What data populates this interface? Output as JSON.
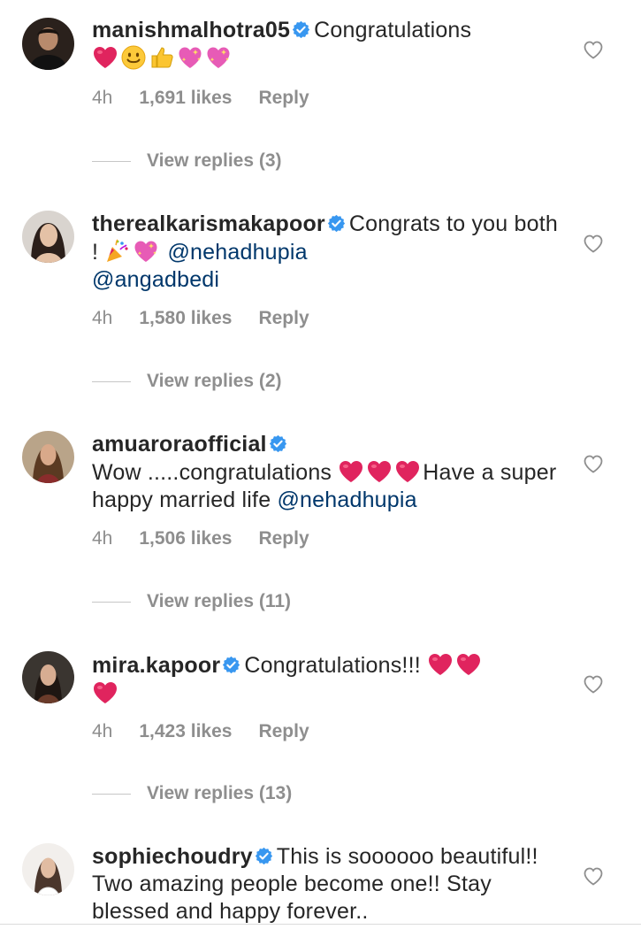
{
  "comments": [
    {
      "username": "manishmalhotra05",
      "text": "Congratulations",
      "time": "4h",
      "likes": "1,691 likes",
      "reply": "Reply",
      "view_replies": "View replies (3)"
    },
    {
      "username": "therealkarismakapoor",
      "text_1": "Congrats to you both !",
      "mention_1": "@nehadhupia",
      "mention_2": "@angadbedi",
      "time": "4h",
      "likes": "1,580 likes",
      "reply": "Reply",
      "view_replies": "View replies (2)"
    },
    {
      "username": "amuaroraofficial",
      "text_1": "Wow .....congratulations",
      "text_2": "Have a super happy married life",
      "mention_1": "@nehadhupia",
      "time": "4h",
      "likes": "1,506 likes",
      "reply": "Reply",
      "view_replies": "View replies (11)"
    },
    {
      "username": "mira.kapoor",
      "text": "Congratulations!!!",
      "time": "4h",
      "likes": "1,423 likes",
      "reply": "Reply",
      "view_replies": "View replies (13)"
    },
    {
      "username": "sophiechoudry",
      "text": "This is soooooo beautiful!! Two amazing people become one!! Stay blessed and happy forever.."
    }
  ],
  "colors": {
    "verified": "#3897f0",
    "mention": "#00376b",
    "secondary_text": "#8e8e8e",
    "heart_emoji": "#e0245e"
  },
  "icons": {
    "verified": "verified-badge-icon",
    "like": "heart-outline-icon"
  }
}
